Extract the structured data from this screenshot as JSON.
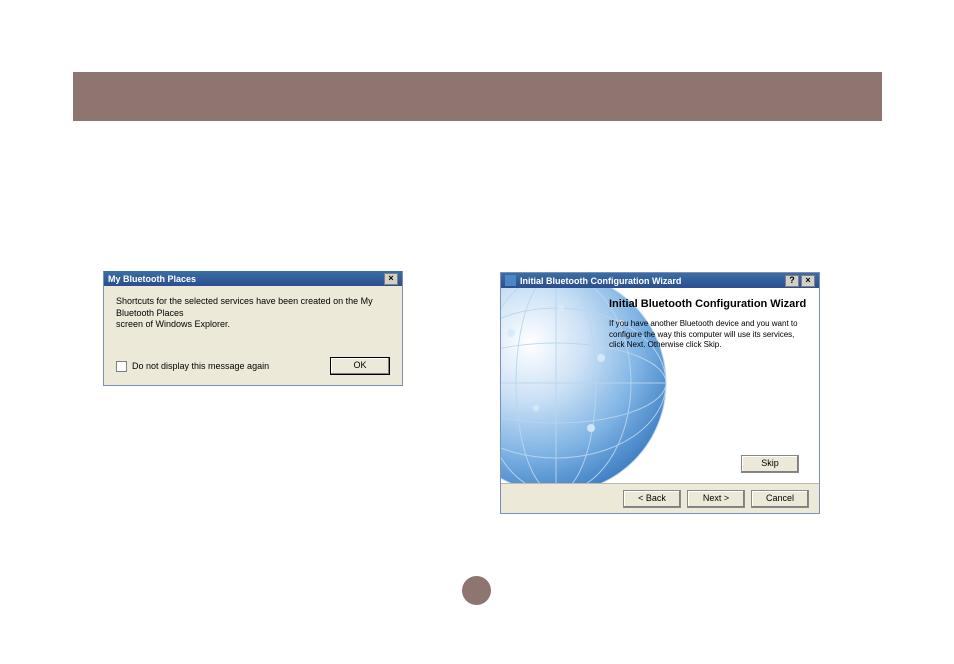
{
  "dialog1": {
    "title": "My Bluetooth Places",
    "message_line1": "Shortcuts for the selected services have been created on the My Bluetooth Places",
    "message_line2": "screen of Windows Explorer.",
    "checkbox_label": "Do not display this message again",
    "ok_label": "OK"
  },
  "dialog2": {
    "title": "Initial Bluetooth Configuration Wizard",
    "help_glyph": "?",
    "close_glyph": "×",
    "heading": "Initial Bluetooth Configuration Wizard",
    "subtext": "If you have another Bluetooth device and you want to configure the way this computer will use its services, click Next. Otherwise click Skip.",
    "skip_label": "Skip",
    "back_label": "< Back",
    "next_label": "Next >",
    "cancel_label": "Cancel"
  }
}
